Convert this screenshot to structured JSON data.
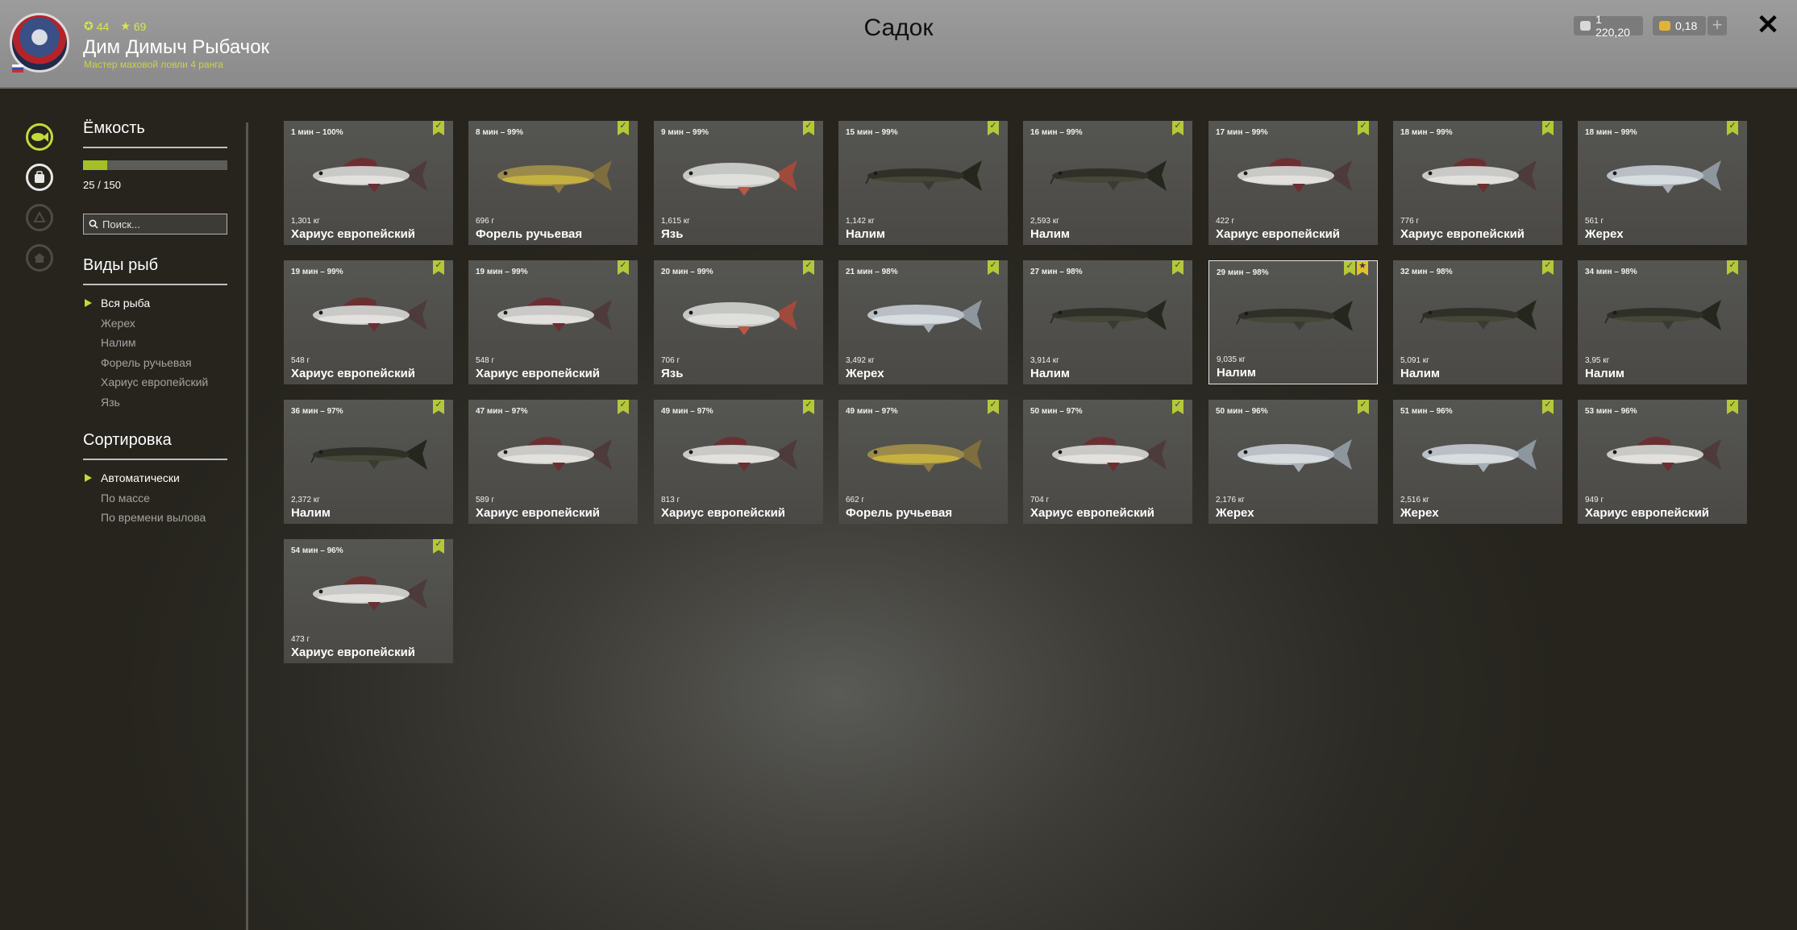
{
  "header": {
    "title": "Садок",
    "player": {
      "name": "Дим Димыч Рыбачок",
      "rank": "Мастер маховой ловли 4 ранга",
      "level": "44",
      "rating": "69"
    },
    "currency": {
      "silver": "1 220,20",
      "gold": "0,18",
      "add": "+"
    },
    "close": "✕"
  },
  "sidebar": {
    "capacity": {
      "title": "Ёмкость",
      "text": "25 / 150",
      "fill": 0.1667
    },
    "search": {
      "placeholder": "Поиск..."
    },
    "species": {
      "title": "Виды рыб",
      "items": [
        "Вся рыба",
        "Жерех",
        "Налим",
        "Форель ручьевая",
        "Хариус европейский",
        "Язь"
      ],
      "active": 0
    },
    "sort": {
      "title": "Сортировка",
      "items": [
        "Автоматически",
        "По массе",
        "По времени вылова"
      ],
      "active": 0
    }
  },
  "fish_cards": [
    {
      "meta": "1 мин – 100%",
      "weight": "1,301 кг",
      "name": "Хариус европейский",
      "kind": "grayling"
    },
    {
      "meta": "8 мин – 99%",
      "weight": "696 г",
      "name": "Форель ручьевая",
      "kind": "trout"
    },
    {
      "meta": "9 мин – 99%",
      "weight": "1,615 кг",
      "name": "Язь",
      "kind": "ide"
    },
    {
      "meta": "15 мин – 99%",
      "weight": "1,142 кг",
      "name": "Налим",
      "kind": "burbot"
    },
    {
      "meta": "16 мин – 99%",
      "weight": "2,593 кг",
      "name": "Налим",
      "kind": "burbot"
    },
    {
      "meta": "17 мин – 99%",
      "weight": "422 г",
      "name": "Хариус европейский",
      "kind": "grayling"
    },
    {
      "meta": "18 мин – 99%",
      "weight": "776 г",
      "name": "Хариус европейский",
      "kind": "grayling"
    },
    {
      "meta": "18 мин – 99%",
      "weight": "561 г",
      "name": "Жерех",
      "kind": "asp"
    },
    {
      "meta": "19 мин – 99%",
      "weight": "548 г",
      "name": "Хариус европейский",
      "kind": "grayling"
    },
    {
      "meta": "19 мин – 99%",
      "weight": "548 г",
      "name": "Хариус европейский",
      "kind": "grayling"
    },
    {
      "meta": "20 мин – 99%",
      "weight": "706 г",
      "name": "Язь",
      "kind": "ide"
    },
    {
      "meta": "21 мин – 98%",
      "weight": "3,492 кг",
      "name": "Жерех",
      "kind": "asp"
    },
    {
      "meta": "27 мин – 98%",
      "weight": "3,914 кг",
      "name": "Налим",
      "kind": "burbot"
    },
    {
      "meta": "29 мин – 98%",
      "weight": "9,035 кг",
      "name": "Налим",
      "kind": "burbot",
      "selected": true,
      "trophy": true
    },
    {
      "meta": "32 мин – 98%",
      "weight": "5,091 кг",
      "name": "Налим",
      "kind": "burbot"
    },
    {
      "meta": "34 мин – 98%",
      "weight": "3,95 кг",
      "name": "Налим",
      "kind": "burbot"
    },
    {
      "meta": "36 мин – 97%",
      "weight": "2,372 кг",
      "name": "Налим",
      "kind": "burbot"
    },
    {
      "meta": "47 мин – 97%",
      "weight": "589 г",
      "name": "Хариус европейский",
      "kind": "grayling"
    },
    {
      "meta": "49 мин – 97%",
      "weight": "813 г",
      "name": "Хариус европейский",
      "kind": "grayling"
    },
    {
      "meta": "49 мин – 97%",
      "weight": "662 г",
      "name": "Форель ручьевая",
      "kind": "trout"
    },
    {
      "meta": "50 мин – 97%",
      "weight": "704 г",
      "name": "Хариус европейский",
      "kind": "grayling"
    },
    {
      "meta": "50 мин – 96%",
      "weight": "2,176 кг",
      "name": "Жерех",
      "kind": "asp"
    },
    {
      "meta": "51 мин – 96%",
      "weight": "2,516 кг",
      "name": "Жерех",
      "kind": "asp"
    },
    {
      "meta": "53 мин – 96%",
      "weight": "949 г",
      "name": "Хариус европейский",
      "kind": "grayling"
    },
    {
      "meta": "54 мин – 96%",
      "weight": "473 г",
      "name": "Хариус европейский",
      "kind": "grayling"
    }
  ],
  "icons": {
    "rail": [
      "keepnet-fish-icon",
      "bag-icon",
      "boat-icon",
      "home-icon"
    ],
    "card_flags": [
      "checkmark-ribbon-icon",
      "star-ribbon-icon"
    ]
  },
  "colors": {
    "accent": "#c5d93a",
    "header_bg": "#949494",
    "card_bg": "#51504c",
    "trophy": "#e0c22e"
  }
}
